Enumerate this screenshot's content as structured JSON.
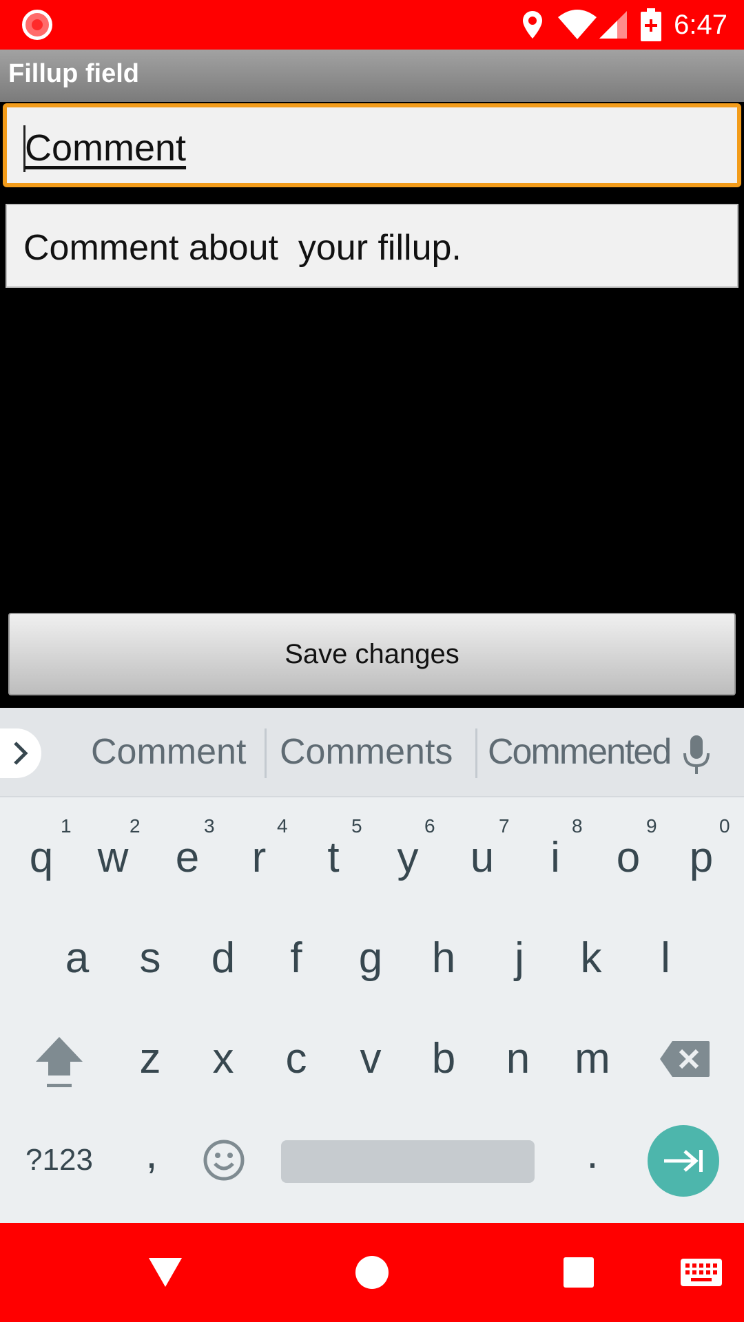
{
  "status_bar": {
    "time": "6:47",
    "icons": [
      "record-icon",
      "location-icon",
      "wifi-icon",
      "signal-icon",
      "battery-charging-icon"
    ]
  },
  "title_bar": {
    "title": "Fillup field"
  },
  "form": {
    "field_name": {
      "value": "Comment"
    },
    "field_value": {
      "value": "Comment about  your fillup."
    },
    "save_button": {
      "label": "Save changes"
    }
  },
  "keyboard": {
    "suggestions": [
      "Comment",
      "Comments",
      "Commented"
    ],
    "row1": [
      {
        "key": "q",
        "hint": "1"
      },
      {
        "key": "w",
        "hint": "2"
      },
      {
        "key": "e",
        "hint": "3"
      },
      {
        "key": "r",
        "hint": "4"
      },
      {
        "key": "t",
        "hint": "5"
      },
      {
        "key": "y",
        "hint": "6"
      },
      {
        "key": "u",
        "hint": "7"
      },
      {
        "key": "i",
        "hint": "8"
      },
      {
        "key": "o",
        "hint": "9"
      },
      {
        "key": "p",
        "hint": "0"
      }
    ],
    "row2": [
      "a",
      "s",
      "d",
      "f",
      "g",
      "h",
      "j",
      "k",
      "l"
    ],
    "row3": [
      "z",
      "x",
      "c",
      "v",
      "b",
      "n",
      "m"
    ],
    "symbols_label": "?123",
    "comma": ",",
    "period": ".",
    "accent_color": "#4db6ac"
  },
  "nav_bar": {
    "icons": [
      "back-icon",
      "home-icon",
      "recents-icon",
      "keyboard-icon"
    ]
  },
  "colors": {
    "status_bar": "#ff0000",
    "focus_border": "#f39c1a"
  }
}
